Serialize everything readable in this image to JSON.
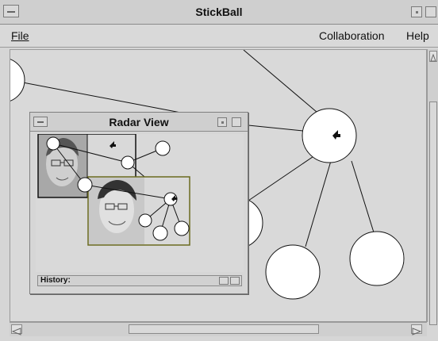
{
  "window": {
    "title": "StickBall"
  },
  "menubar": {
    "file": "File",
    "collaboration": "Collaboration",
    "help": "Help"
  },
  "radar": {
    "title": "Radar View",
    "history_label": "History:"
  },
  "colors": {
    "background": "#d9d9d9",
    "node_fill": "#ffffff",
    "view_frame": "#6b6b1f",
    "edge": "#111111"
  }
}
